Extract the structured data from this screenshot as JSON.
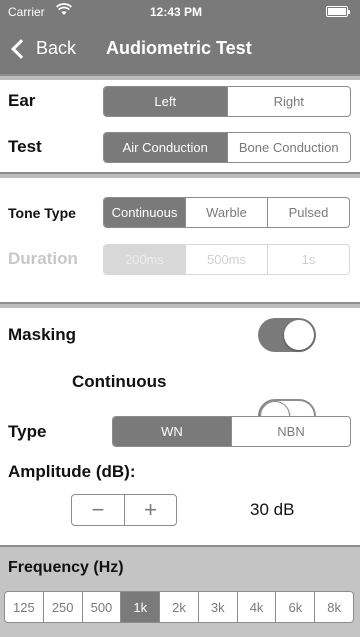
{
  "status": {
    "carrier": "Carrier",
    "time": "12:43 PM"
  },
  "nav": {
    "back_label": "Back",
    "title": "Audiometric Test"
  },
  "ear": {
    "label": "Ear",
    "options": [
      "Left",
      "Right"
    ],
    "selected": "Left"
  },
  "test": {
    "label": "Test",
    "options": [
      "Air Conduction",
      "Bone Conduction"
    ],
    "selected": "Air Conduction"
  },
  "tone_type": {
    "label": "Tone Type",
    "options": [
      "Continuous",
      "Warble",
      "Pulsed"
    ],
    "selected": "Continuous"
  },
  "duration": {
    "label": "Duration",
    "options": [
      "200ms",
      "500ms",
      "1s"
    ],
    "selected": "200ms",
    "enabled": false
  },
  "masking": {
    "label": "Masking",
    "on": true,
    "continuous_label": "Continuous",
    "continuous_on": false
  },
  "type": {
    "label": "Type",
    "options": [
      "WN",
      "NBN"
    ],
    "selected": "WN"
  },
  "amplitude": {
    "label": "Amplitude (dB):",
    "minus": "−",
    "plus": "+",
    "value": "30 dB"
  },
  "frequency": {
    "label": "Frequency (Hz)",
    "options": [
      "125",
      "250",
      "500",
      "1k",
      "2k",
      "3k",
      "4k",
      "6k",
      "8k"
    ],
    "selected": "1k"
  }
}
